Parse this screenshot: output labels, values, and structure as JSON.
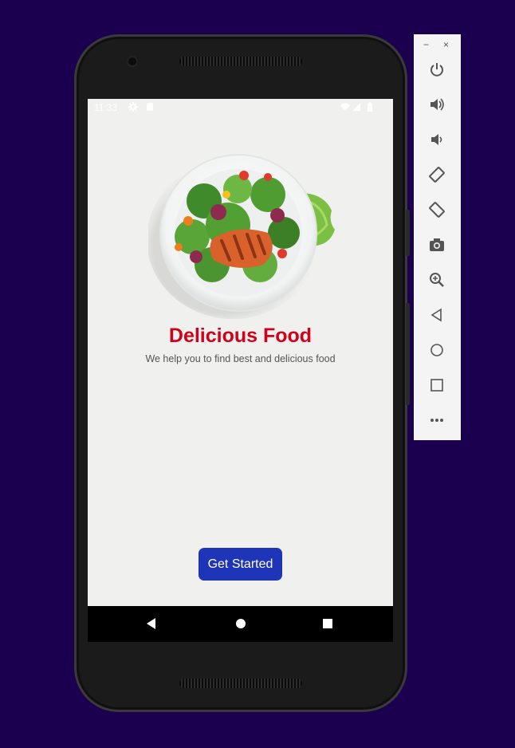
{
  "status_bar": {
    "time": "11:33"
  },
  "app": {
    "title": "Delicious Food",
    "subtitle": "We help you to find best and delicious food",
    "cta_label": "Get Started",
    "colors": {
      "title": "#d0021b",
      "button": "#1f35b7",
      "background": "#f0f0ee"
    }
  },
  "emulator_toolbar": {
    "window_controls": {
      "minimize": "−",
      "close": "×"
    },
    "buttons": [
      "power-icon",
      "volume-up-icon",
      "volume-down-icon",
      "rotate-left-icon",
      "rotate-right-icon",
      "camera-icon",
      "zoom-icon",
      "back-icon",
      "home-icon",
      "overview-icon",
      "more-icon"
    ]
  },
  "nav_bar": [
    "back-icon",
    "home-icon",
    "recents-icon"
  ]
}
